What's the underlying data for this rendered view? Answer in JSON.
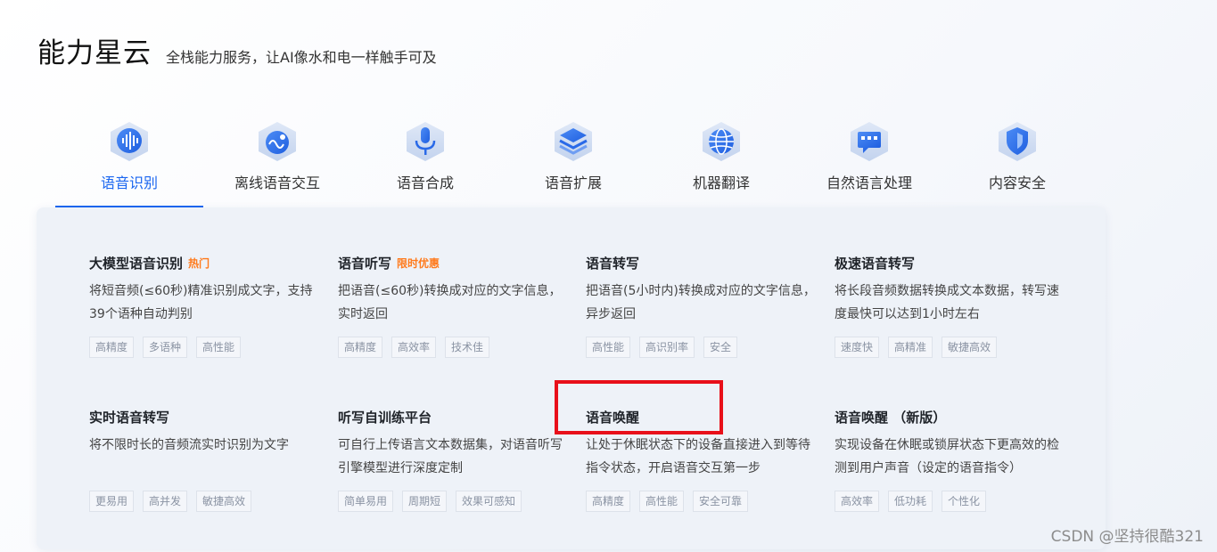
{
  "header": {
    "title": "能力星云",
    "subtitle": "全栈能力服务，让AI像水和电一样触手可及"
  },
  "tabs": [
    {
      "label": "语音识别",
      "icon": "voice-wave-icon"
    },
    {
      "label": "离线语音交互",
      "icon": "offline-voice-icon"
    },
    {
      "label": "语音合成",
      "icon": "microphone-icon"
    },
    {
      "label": "语音扩展",
      "icon": "grid-chip-icon"
    },
    {
      "label": "机器翻译",
      "icon": "globe-icon"
    },
    {
      "label": "自然语言处理",
      "icon": "text-chat-icon"
    },
    {
      "label": "内容安全",
      "icon": "shield-icon"
    }
  ],
  "cards": [
    {
      "title": "大模型语音识别",
      "badge": "热门",
      "desc": "将短音频(≤60秒)精准识别成文字，支持39个语种自动判别",
      "tags": [
        "高精度",
        "多语种",
        "高性能"
      ]
    },
    {
      "title": "语音听写",
      "badge": "限时优惠",
      "desc": "把语音(≤60秒)转换成对应的文字信息，实时返回",
      "tags": [
        "高精度",
        "高效率",
        "技术佳"
      ]
    },
    {
      "title": "语音转写",
      "badge": "",
      "desc": "把语音(5小时内)转换成对应的文字信息，异步返回",
      "tags": [
        "高性能",
        "高识别率",
        "安全"
      ]
    },
    {
      "title": "极速语音转写",
      "badge": "",
      "desc": "将长段音频数据转换成文本数据，转写速度最快可以达到1小时左右",
      "tags": [
        "速度快",
        "高精准",
        "敏捷高效"
      ]
    },
    {
      "title": "实时语音转写",
      "badge": "",
      "desc": "将不限时长的音频流实时识别为文字",
      "tags": [
        "更易用",
        "高并发",
        "敏捷高效"
      ]
    },
    {
      "title": "听写自训练平台",
      "badge": "",
      "desc": "可自行上传语言文本数据集，对语音听写引擎模型进行深度定制",
      "tags": [
        "简单易用",
        "周期短",
        "效果可感知"
      ]
    },
    {
      "title": "语音唤醒",
      "badge": "",
      "desc": "让处于休眠状态下的设备直接进入到等待指令状态，开启语音交互第一步",
      "tags": [
        "高精度",
        "高性能",
        "安全可靠"
      ]
    },
    {
      "title": "语音唤醒 （新版）",
      "badge": "",
      "desc": "实现设备在休眠或锁屏状态下更高效的检测到用户声音（设定的语音指令）",
      "tags": [
        "高效率",
        "低功耗",
        "个性化"
      ]
    }
  ],
  "colors": {
    "accent": "#1a66f0",
    "badge": "#ff7a1c",
    "highlight": "#e8101a"
  },
  "watermark": "CSDN @坚持很酷321"
}
